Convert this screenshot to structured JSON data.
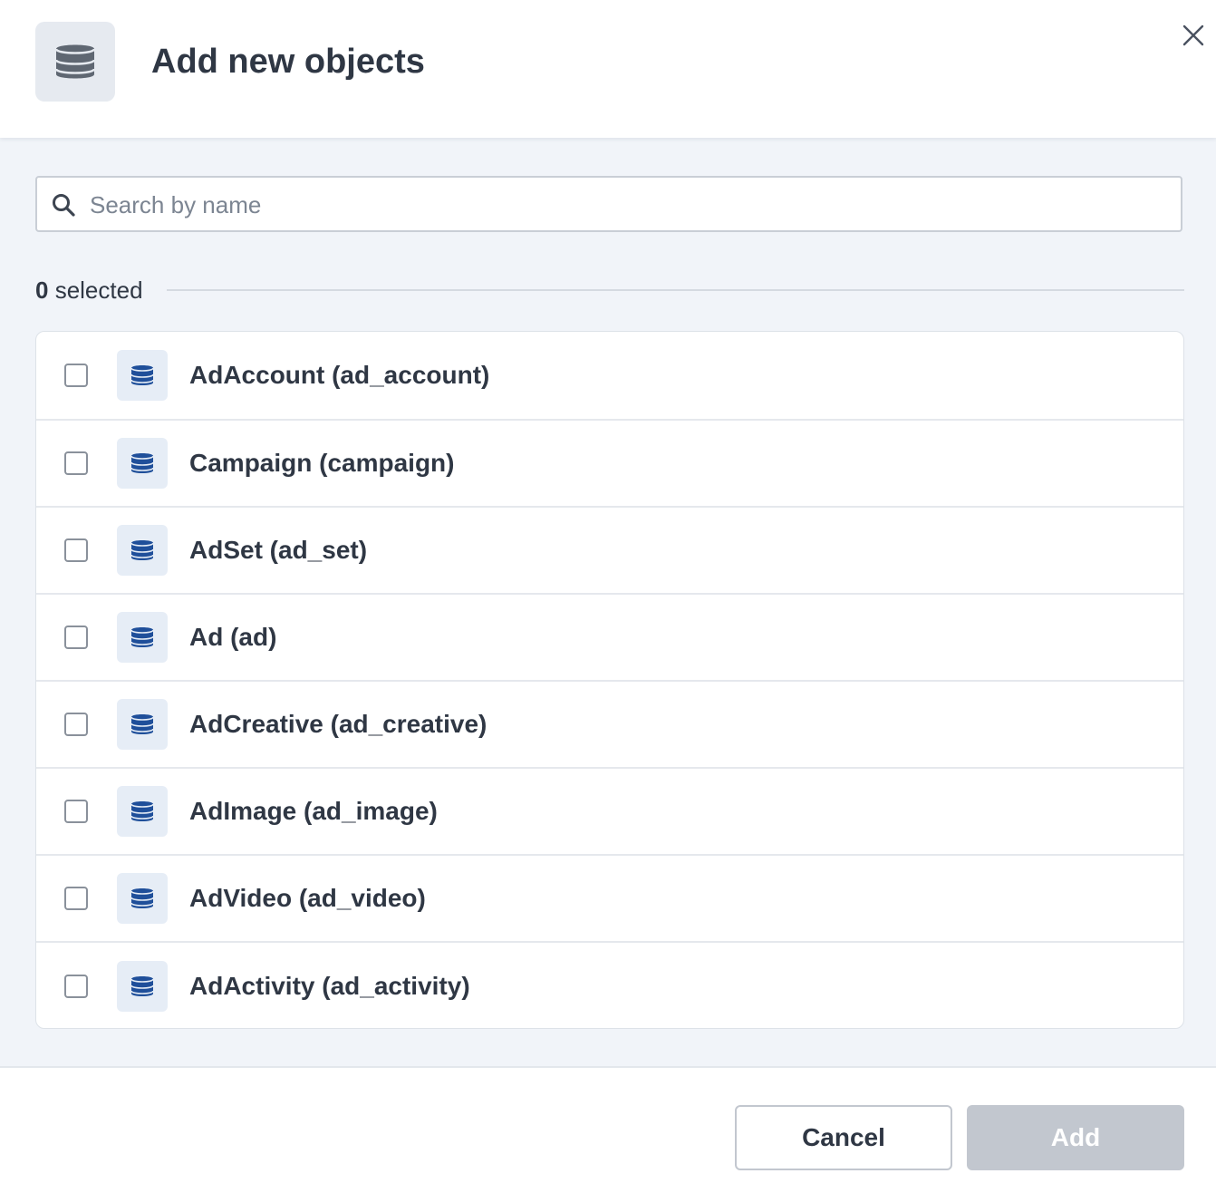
{
  "header": {
    "title": "Add new objects",
    "icon": "database-icon",
    "close_icon": "close-icon"
  },
  "search": {
    "placeholder": "Search by name",
    "value": "",
    "icon": "search-icon"
  },
  "selection": {
    "count": "0",
    "suffix": " selected"
  },
  "objects": [
    {
      "label": "AdAccount (ad_account)",
      "checked": false,
      "icon": "database-icon"
    },
    {
      "label": "Campaign (campaign)",
      "checked": false,
      "icon": "database-icon"
    },
    {
      "label": "AdSet (ad_set)",
      "checked": false,
      "icon": "database-icon"
    },
    {
      "label": "Ad (ad)",
      "checked": false,
      "icon": "database-icon"
    },
    {
      "label": "AdCreative (ad_creative)",
      "checked": false,
      "icon": "database-icon"
    },
    {
      "label": "AdImage (ad_image)",
      "checked": false,
      "icon": "database-icon"
    },
    {
      "label": "AdVideo (ad_video)",
      "checked": false,
      "icon": "database-icon"
    },
    {
      "label": "AdActivity (ad_activity)",
      "checked": false,
      "icon": "database-icon"
    }
  ],
  "footer": {
    "cancel_label": "Cancel",
    "add_label": "Add",
    "add_disabled": true
  },
  "colors": {
    "header_icon": "#5f6772",
    "item_icon": "#1f4f9a",
    "add_button_disabled": "#c2c7cf",
    "panel_background": "#f1f4f9"
  }
}
